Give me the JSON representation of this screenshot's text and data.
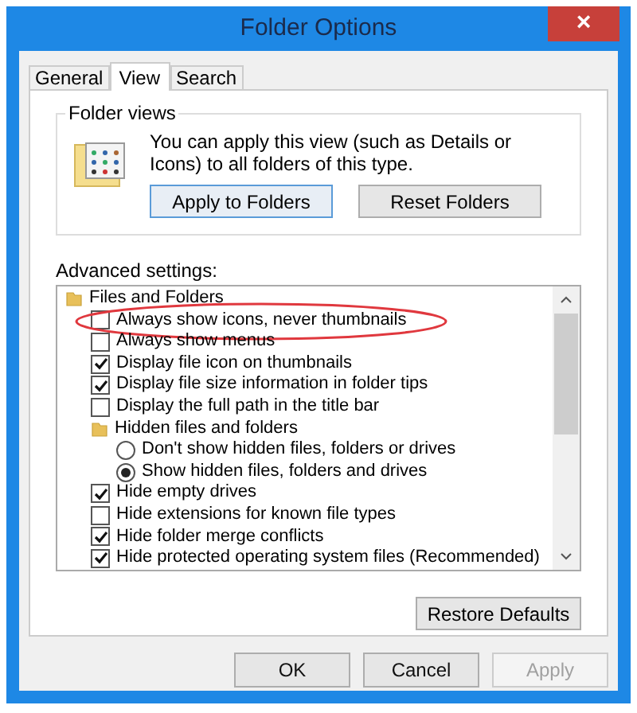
{
  "window": {
    "title": "Folder Options",
    "close": "×"
  },
  "tabs": [
    {
      "label": "General",
      "selected": false
    },
    {
      "label": "View",
      "selected": true
    },
    {
      "label": "Search",
      "selected": false
    }
  ],
  "folder_views": {
    "title": "Folder views",
    "description": "You can apply this view (such as Details or Icons) to all folders of this type.",
    "buttons": [
      {
        "label": "Apply to Folders",
        "selected": true
      },
      {
        "label": "Reset Folders",
        "selected": false
      }
    ]
  },
  "advanced": {
    "label": "Advanced settings:",
    "items": [
      {
        "kind": "group",
        "label": "Files and Folders",
        "children": [
          {
            "kind": "checkbox",
            "label": "Always show icons, never thumbnails",
            "checked": false,
            "highlighted": true
          },
          {
            "kind": "checkbox",
            "label": "Always show menus",
            "checked": false
          },
          {
            "kind": "checkbox",
            "label": "Display file icon on thumbnails",
            "checked": true
          },
          {
            "kind": "checkbox",
            "label": "Display file size information in folder tips",
            "checked": true
          },
          {
            "kind": "checkbox",
            "label": "Display the full path in the title bar",
            "checked": false
          },
          {
            "kind": "group",
            "label": "Hidden files and folders",
            "children": [
              {
                "kind": "radio",
                "label": "Don't show hidden files, folders or drives",
                "selected": false
              },
              {
                "kind": "radio",
                "label": "Show hidden files, folders and drives",
                "selected": true
              }
            ]
          },
          {
            "kind": "checkbox",
            "label": "Hide empty drives",
            "checked": true
          },
          {
            "kind": "checkbox",
            "label": "Hide extensions for known file types",
            "checked": false
          },
          {
            "kind": "checkbox",
            "label": "Hide folder merge conflicts",
            "checked": true
          },
          {
            "kind": "checkbox",
            "label": "Hide protected operating system files (Recommended)",
            "checked": true
          }
        ]
      }
    ]
  },
  "restore_button": "Restore Defaults",
  "buttons": [
    {
      "label": "OK",
      "disabled": false
    },
    {
      "label": "Cancel",
      "disabled": false
    },
    {
      "label": "Apply",
      "disabled": true
    }
  ]
}
